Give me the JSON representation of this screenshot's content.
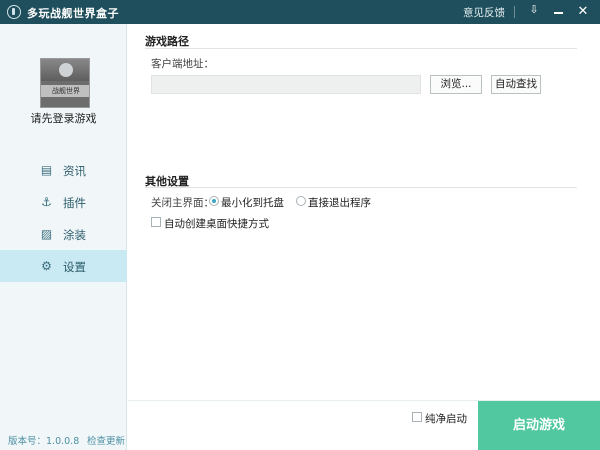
{
  "titlebar": {
    "title": "多玩战舰世界盒子",
    "feedback": "意见反馈",
    "menu_icon": "menu-down-icon",
    "min_icon": "minimize-icon",
    "close_icon": "close-icon",
    "close_glyph": "✕",
    "menu_glyph": "⇩"
  },
  "sidebar": {
    "login_text": "请先登录游戏",
    "avatar_badge": "战舰世界",
    "items": [
      {
        "label": "资讯",
        "icon": "news-icon",
        "glyph": "▤",
        "active": false
      },
      {
        "label": "插件",
        "icon": "anchor-icon",
        "glyph": "⚓",
        "active": false
      },
      {
        "label": "涂装",
        "icon": "paint-icon",
        "glyph": "▨",
        "active": false
      },
      {
        "label": "设置",
        "icon": "gear-icon",
        "glyph": "⚙",
        "active": true
      }
    ],
    "version": "版本号：1.0.0.8",
    "check_update": "检查更新"
  },
  "main": {
    "game_path": {
      "title": "游戏路径",
      "client_label": "客户端地址：",
      "path_value": "",
      "browse_button": "浏览...",
      "auto_find_button": "自动查找"
    },
    "other_settings": {
      "title": "其他设置",
      "close_label": "关闭主界面：",
      "options": [
        {
          "label": "最小化到托盘",
          "checked": true
        },
        {
          "label": "直接退出程序",
          "checked": false
        }
      ],
      "desktop_shortcut": {
        "label": "自动创建桌面快捷方式",
        "checked": false
      }
    }
  },
  "footer": {
    "pure_start_label": "纯净启动",
    "pure_start_checked": false,
    "start_button": "启动游戏"
  },
  "colors": {
    "titlebar": "#1f4f5c",
    "sidebar": "#f1f7f9",
    "active_nav": "#c9eaf3",
    "accent": "#39a6c4",
    "start_button": "#52c8a0"
  }
}
